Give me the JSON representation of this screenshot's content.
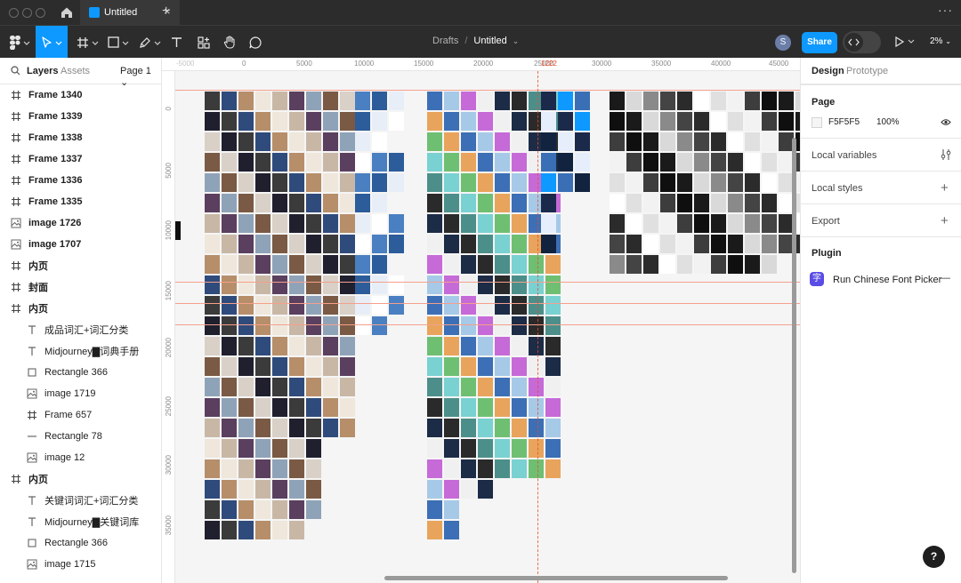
{
  "titlebar": {
    "tab_label": "Untitled",
    "tab_close": "×",
    "new_tab": "+",
    "more": "···"
  },
  "toolbar": {
    "breadcrumb_parent": "Drafts",
    "breadcrumb_sep": "/",
    "breadcrumb_file": "Untitled",
    "breadcrumb_chevron": "⌄",
    "avatar_initial": "S",
    "share_label": "Share",
    "zoom_level": "2%",
    "active_tool": "move",
    "tools": [
      "main-menu",
      "move",
      "frame",
      "shape",
      "pen",
      "text",
      "resources",
      "hand",
      "comment"
    ]
  },
  "left_panel": {
    "tab_layers": "Layers",
    "tab_assets": "Assets",
    "page_selector": "Page 1 ⌄",
    "layers": [
      {
        "label": "Frame 1340",
        "icon": "frame-icon",
        "level": 0
      },
      {
        "label": "Frame 1339",
        "icon": "frame-icon",
        "level": 0
      },
      {
        "label": "Frame 1338",
        "icon": "frame-icon",
        "level": 0
      },
      {
        "label": "Frame 1337",
        "icon": "frame-icon",
        "level": 0
      },
      {
        "label": "Frame 1336",
        "icon": "frame-icon",
        "level": 0
      },
      {
        "label": "Frame 1335",
        "icon": "frame-icon",
        "level": 0
      },
      {
        "label": "image 1726",
        "icon": "image-icon",
        "level": 0
      },
      {
        "label": "image 1707",
        "icon": "image-icon",
        "level": 0
      },
      {
        "label": "内页",
        "icon": "frame-icon",
        "level": 0
      },
      {
        "label": "封面",
        "icon": "frame-icon",
        "level": 0
      },
      {
        "label": "内页",
        "icon": "frame-icon",
        "level": 0
      },
      {
        "label": "成品词汇+词汇分类",
        "icon": "text-icon",
        "level": 1
      },
      {
        "label": "Midjourney▇词典手册",
        "icon": "text-icon",
        "level": 1
      },
      {
        "label": "Rectangle 366",
        "icon": "rectangle-icon",
        "level": 1
      },
      {
        "label": "image 1719",
        "icon": "image-icon",
        "level": 1
      },
      {
        "label": "Frame 657",
        "icon": "frame-icon",
        "level": 1
      },
      {
        "label": "Rectangle 78",
        "icon": "line-icon",
        "level": 1
      },
      {
        "label": "image 12",
        "icon": "image-icon",
        "level": 1
      },
      {
        "label": "内页",
        "icon": "frame-icon",
        "level": 0
      },
      {
        "label": "关键词词汇+词汇分类",
        "icon": "text-icon",
        "level": 1
      },
      {
        "label": "Midjourney▇关键词库",
        "icon": "text-icon",
        "level": 1
      },
      {
        "label": "Rectangle 366",
        "icon": "rectangle-icon",
        "level": 1
      },
      {
        "label": "image 1715",
        "icon": "image-icon",
        "level": 1
      }
    ]
  },
  "canvas": {
    "background": "#f5f5f5",
    "ruler_x_ticks": [
      "-5000",
      "0",
      "5000",
      "10000",
      "15000",
      "20000",
      "25000",
      "30000",
      "35000",
      "40000",
      "45000"
    ],
    "ruler_y_ticks": [
      "0",
      "5000",
      "10000",
      "15000",
      "20000",
      "25000",
      "30000",
      "35000"
    ],
    "guide_marker": "1222",
    "guide_color": "#f24822"
  },
  "right_panel": {
    "tab_design": "Design",
    "tab_prototype": "Prototype",
    "page_section_title": "Page",
    "page_color_hex": "F5F5F5",
    "page_opacity": "100%",
    "local_variables": "Local variables",
    "local_styles": "Local styles",
    "export": "Export",
    "plugin_title": "Plugin",
    "plugin_icon_text": "字",
    "plugin_name": "Run Chinese Font Picker",
    "plugin_remove": "—"
  },
  "help_label": "?",
  "colors": {
    "accent": "#0d99ff",
    "toolbar_bg": "#2c2c2c",
    "plugin_purple": "#5a4de6"
  }
}
